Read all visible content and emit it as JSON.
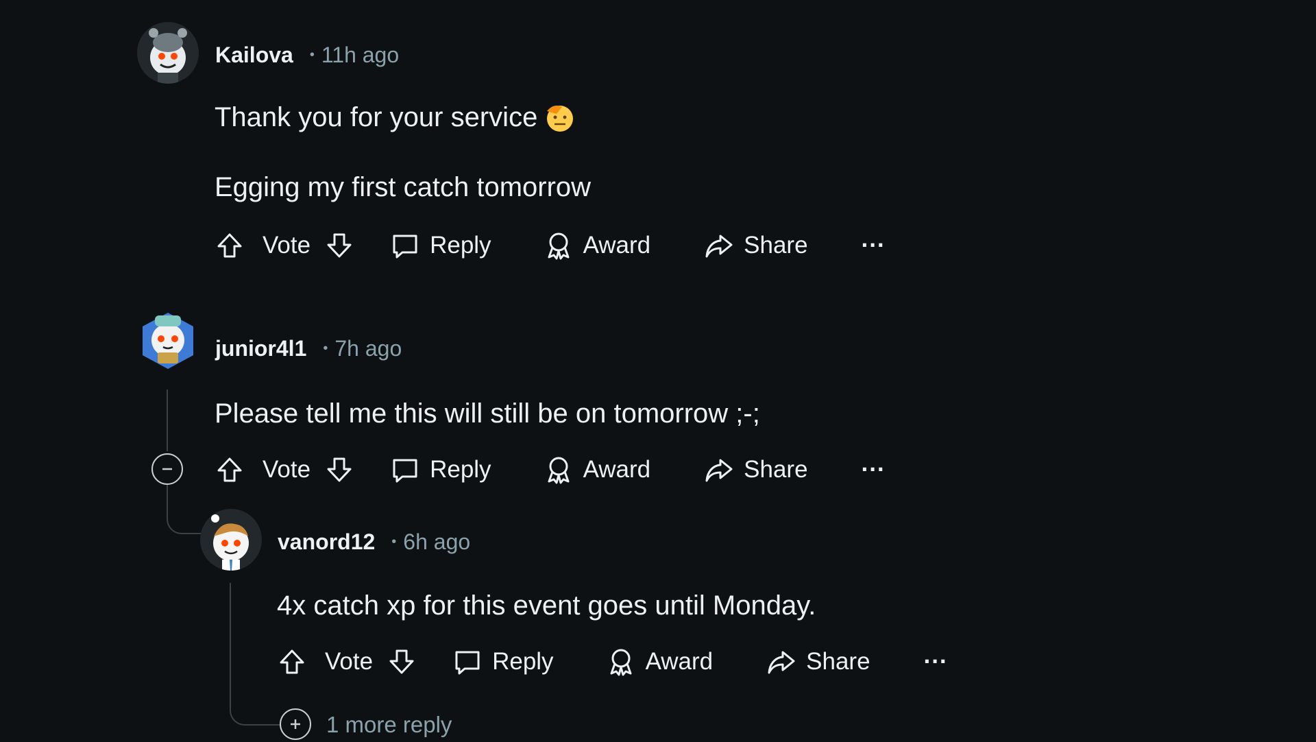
{
  "comments": [
    {
      "username": "Kailova",
      "separator": "•",
      "time": "11h ago",
      "lines": [
        "Thank you for your service",
        "Egging my first catch tomorrow"
      ],
      "emoji": "saluting-face-emoji"
    },
    {
      "username": "junior4l1",
      "separator": "•",
      "time": "7h ago",
      "lines": [
        "Please tell me this will still be on tomorrow ;-;"
      ]
    },
    {
      "username": "vanord12",
      "separator": "•",
      "time": "6h ago",
      "lines": [
        "4x catch xp for this event goes until Monday."
      ]
    }
  ],
  "actions": {
    "vote": "Vote",
    "reply": "Reply",
    "award": "Award",
    "share": "Share",
    "more": "···"
  },
  "more_replies": "1 more reply",
  "icons": [
    "upvote-icon",
    "downvote-icon",
    "comment-icon",
    "award-icon",
    "share-icon",
    "overflow-icon",
    "collapse-icon",
    "expand-icon"
  ],
  "colors": {
    "background": "#0e1113",
    "text": "#eef1f3",
    "secondary": "#8ba2ad",
    "thread_line": "#3b4246"
  }
}
